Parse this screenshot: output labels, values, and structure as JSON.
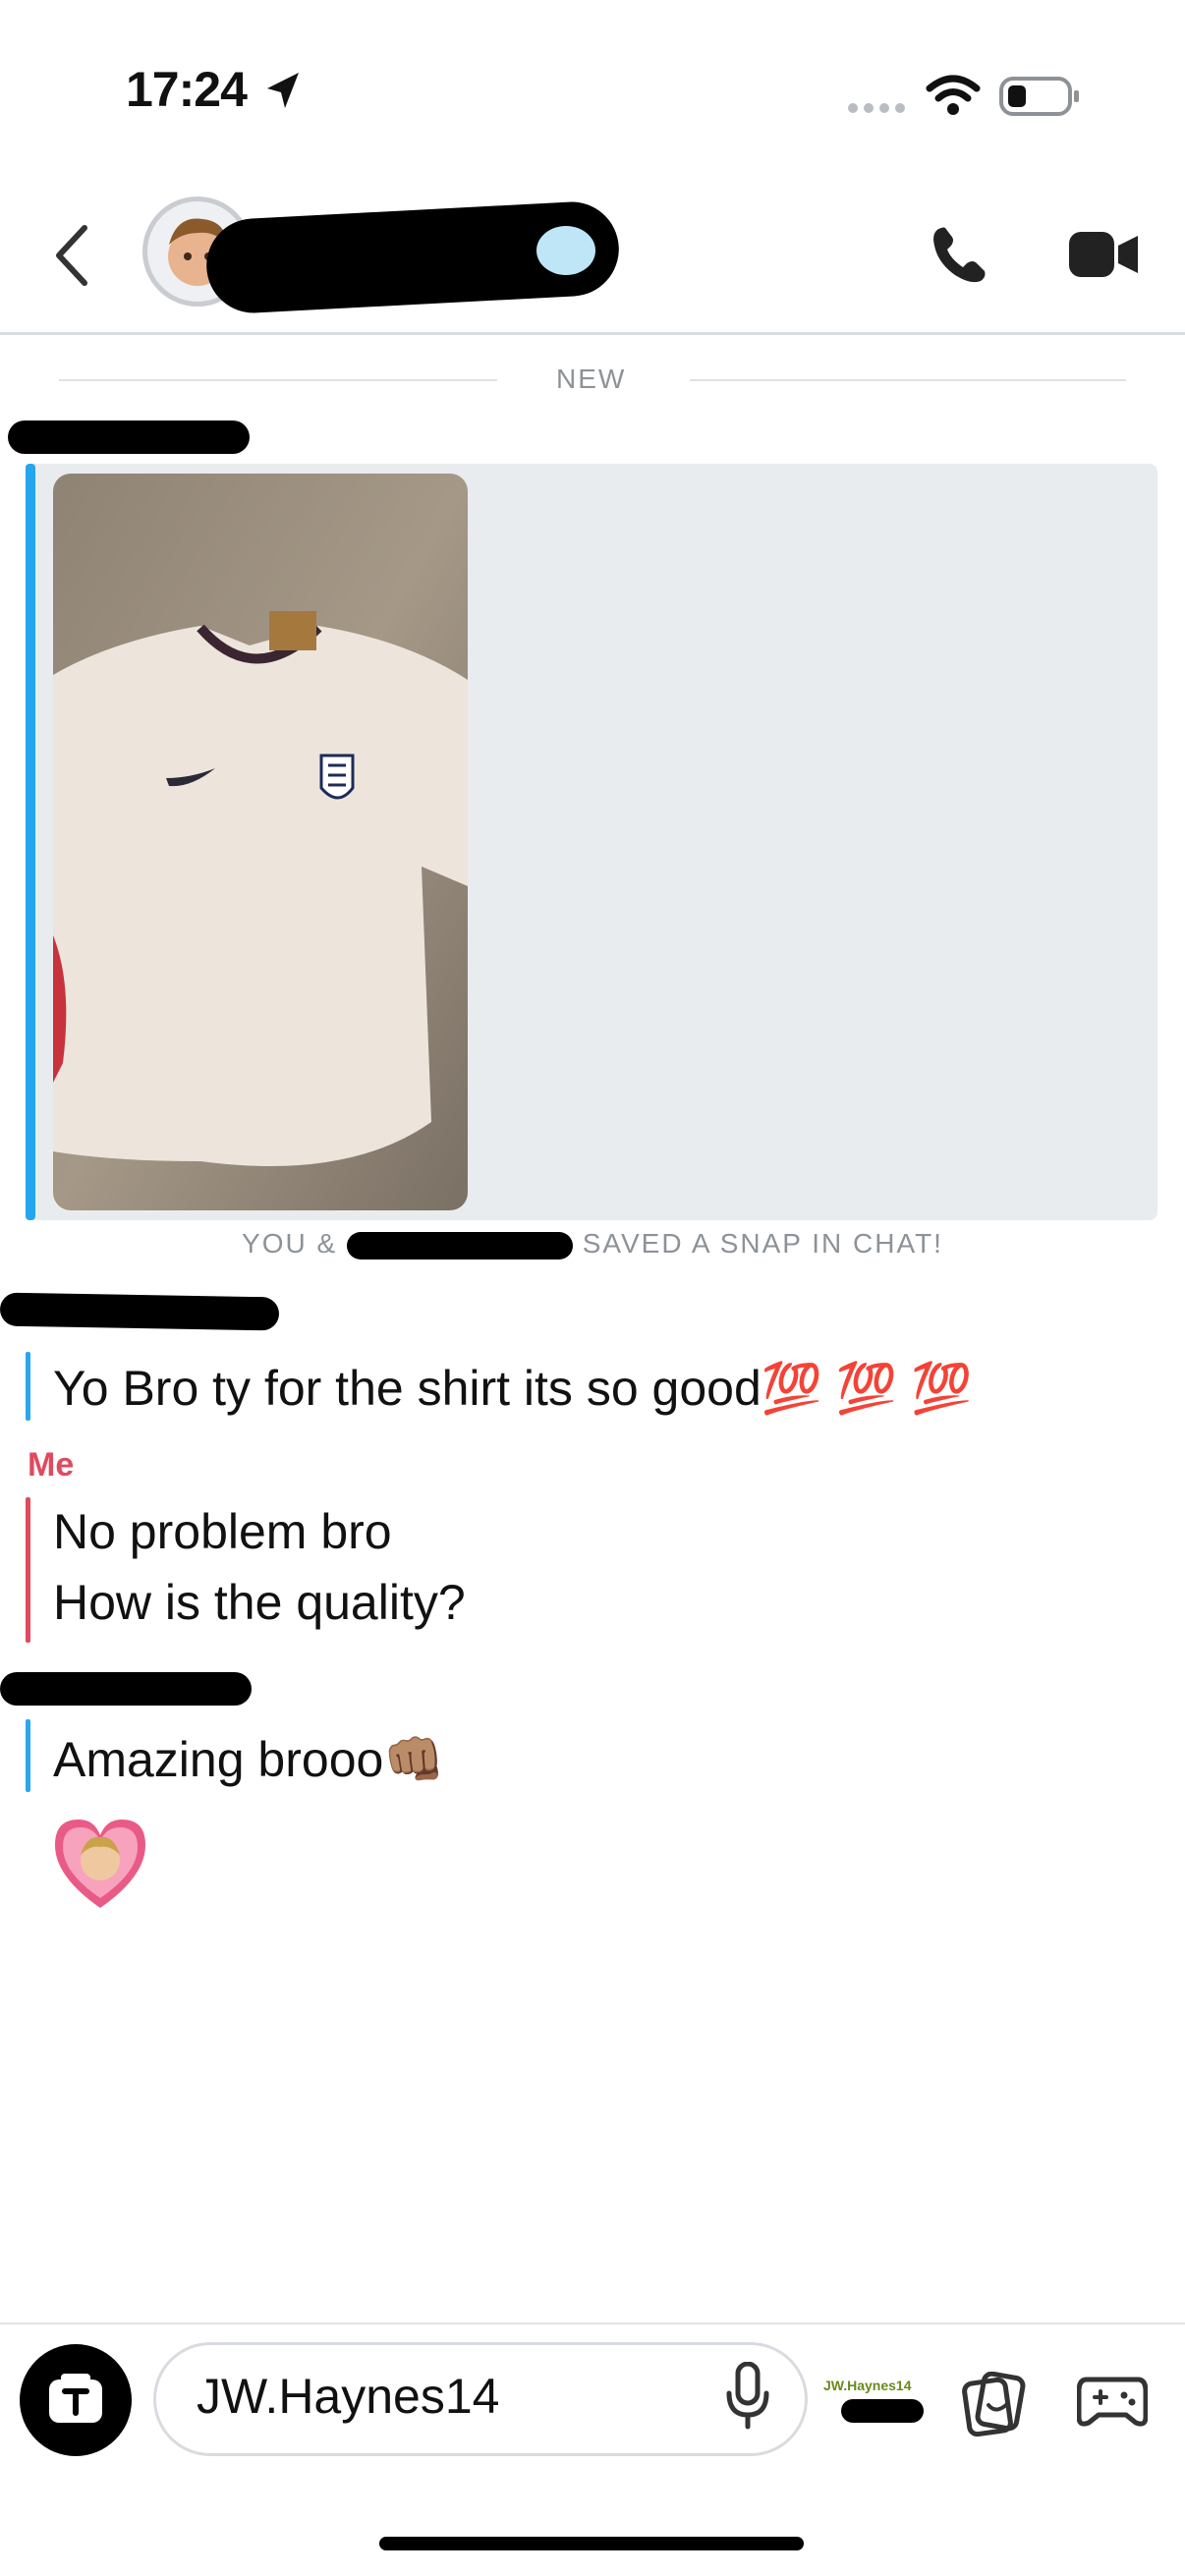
{
  "status_bar": {
    "time": "17:24"
  },
  "divider": {
    "label": "NEW"
  },
  "snap": {
    "saved_note_prefix": "YOU &",
    "saved_note_suffix": "SAVED A SNAP IN CHAT!"
  },
  "messages": [
    {
      "text": "Yo Bro ty for the shirt its so good💯 💯 💯"
    },
    {
      "sender": "Me",
      "lines": [
        "No problem bro",
        "How is the quality?"
      ]
    },
    {
      "text": "Amazing brooo👊🏽"
    }
  ],
  "composer": {
    "text": "JW.Haynes14",
    "mini_label": "JW.Haynes14"
  },
  "colors": {
    "accent_blue": "#2ba7ee",
    "me_red": "#e04a5f",
    "snap_bg": "#e9ecef"
  }
}
